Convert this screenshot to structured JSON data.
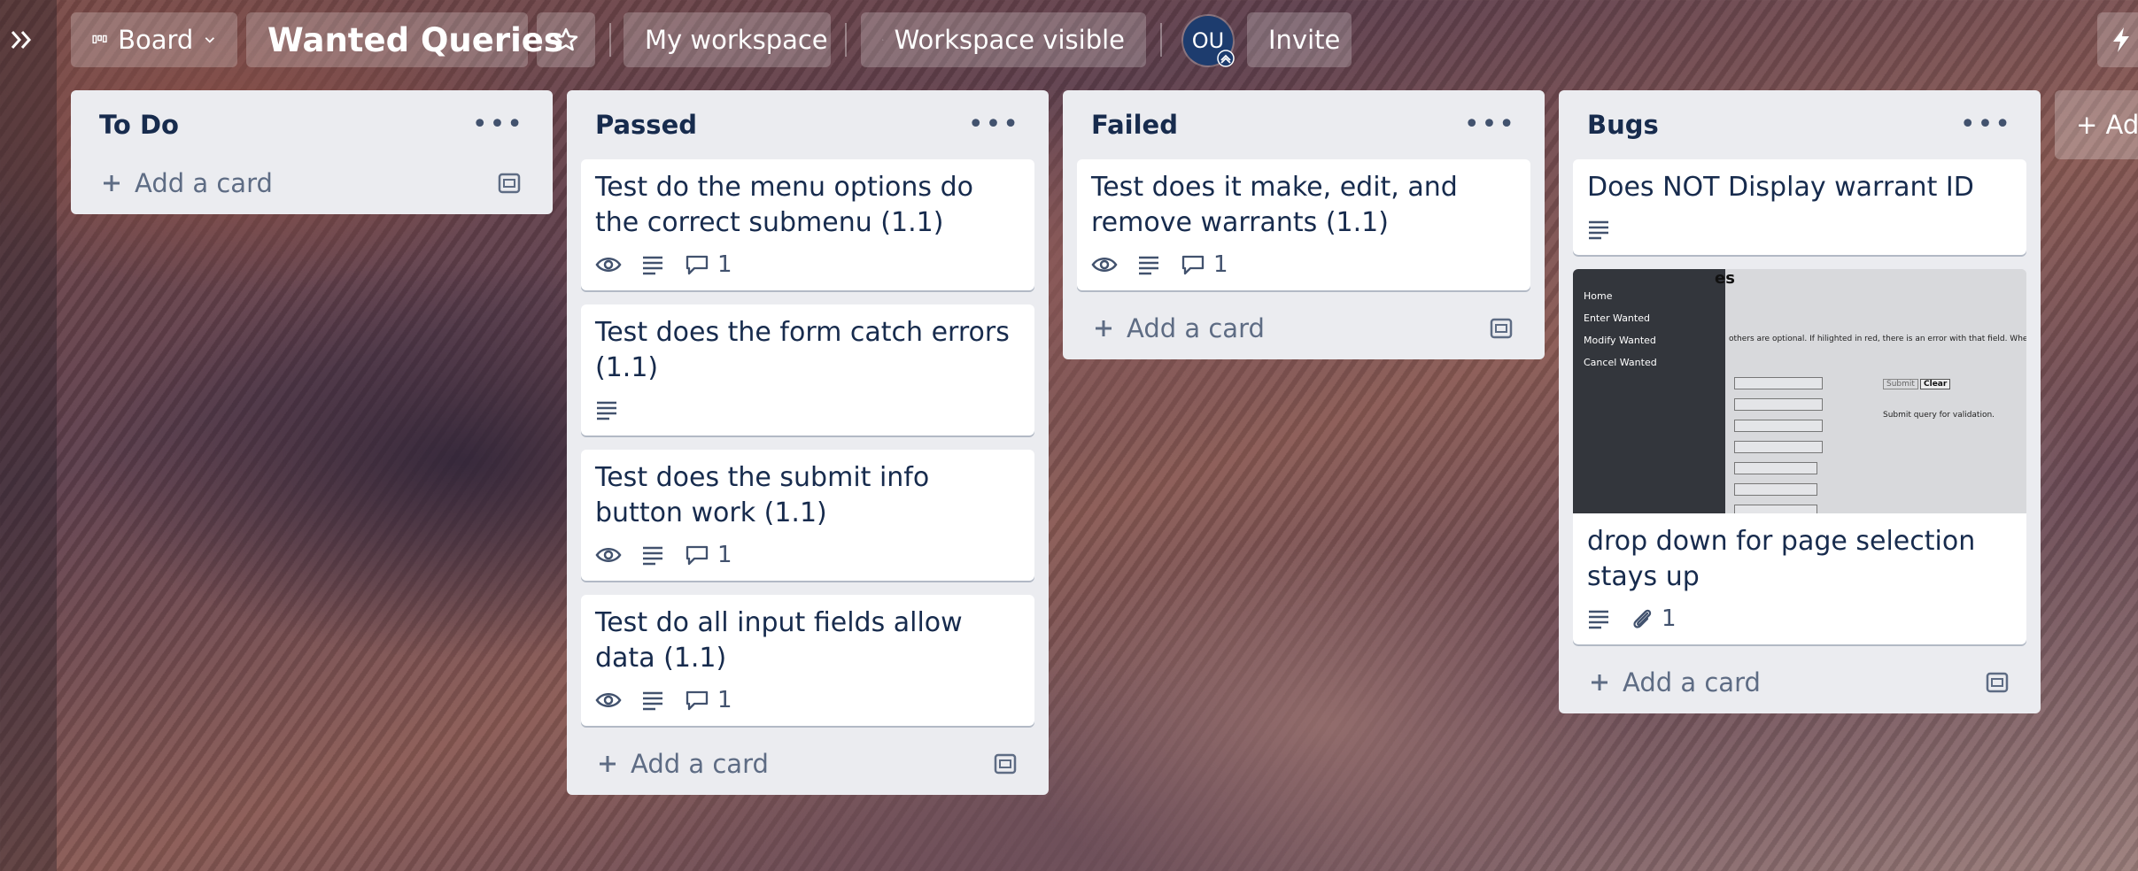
{
  "header": {
    "view_label": "Board",
    "board_title": "Wanted Queries",
    "workspace_label": "My workspace",
    "visibility_label": "Workspace visible",
    "avatar_initials": "OU",
    "invite_label": "Invite",
    "add_list_label": "+ Ad"
  },
  "lists": [
    {
      "title": "To Do",
      "add_card_label": "Add a card",
      "cards": []
    },
    {
      "title": "Passed",
      "add_card_label": "Add a card",
      "cards": [
        {
          "title": "Test do the menu options do the correct submenu (1.1)",
          "watch": true,
          "description": true,
          "comments": "1"
        },
        {
          "title": "Test does the form catch errors (1.1)",
          "watch": false,
          "description": true,
          "comments": null
        },
        {
          "title": "Test does the submit info button work (1.1)",
          "watch": true,
          "description": true,
          "comments": "1"
        },
        {
          "title": "Test do all input fields allow data (1.1)",
          "watch": true,
          "description": true,
          "comments": "1"
        }
      ]
    },
    {
      "title": "Failed",
      "add_card_label": "Add a card",
      "cards": [
        {
          "title": "Test does it make, edit, and remove warrants (1.1)",
          "watch": true,
          "description": true,
          "comments": "1"
        }
      ]
    },
    {
      "title": "Bugs",
      "add_card_label": "Add a card",
      "cards": [
        {
          "title": "Does NOT Display warrant ID",
          "description": true
        },
        {
          "title": "drop down for page selection stays up",
          "description": true,
          "attachments": "1",
          "cover": {
            "menu": [
              "Home",
              "Enter Wanted",
              "Modify Wanted",
              "Cancel Wanted"
            ],
            "heading": "es",
            "notice": "others are optional. If hilighted in red, there is an error with that field. When re",
            "submit": "Submit",
            "clear": "Clear",
            "hint": "Submit query for validation."
          }
        }
      ]
    }
  ],
  "colors": {
    "list_bg": "#ebecf0",
    "card_bg": "#ffffff",
    "text": "#172b4d",
    "muted": "#5e6c84",
    "avatar": "#1d3c6e"
  }
}
